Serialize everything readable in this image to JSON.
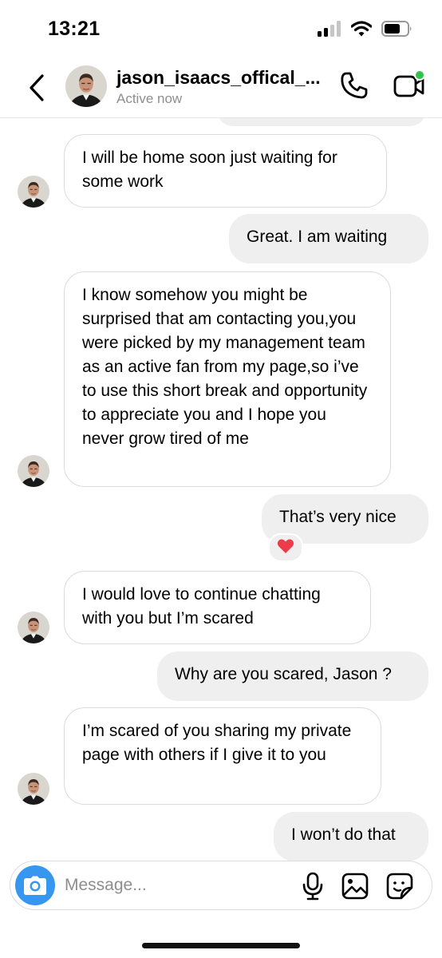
{
  "status_bar": {
    "time": "13:21"
  },
  "header": {
    "username": "jason_isaacs_offical_...",
    "status": "Active now"
  },
  "messages": [
    {
      "from": "them",
      "text": "I will be home soon just waiting for some work"
    },
    {
      "from": "me",
      "text": "Great.   I am waiting"
    },
    {
      "from": "them",
      "text": "I know somehow you might be surprised that am contacting you,you were picked by my management team as an active fan from my page,so i’ve to use this short break and opportunity to appreciate you and I hope you never grow tired of me"
    },
    {
      "from": "me",
      "text": "That’s very nice",
      "reaction": "❤️"
    },
    {
      "from": "them",
      "text": "I would love to continue chatting with you but I’m scared"
    },
    {
      "from": "me",
      "text": "Why are you scared, Jason ?"
    },
    {
      "from": "them",
      "text": "I’m scared of you sharing my private page with others if I give it to you"
    },
    {
      "from": "me",
      "text": "I won’t do that"
    }
  ],
  "composer": {
    "placeholder": "Message..."
  },
  "colors": {
    "accent": "#3797f0",
    "online": "#2ec44a",
    "outgoing_bubble": "#efefef",
    "incoming_border": "#dbdbdb"
  },
  "icons": [
    "signal-icon",
    "wifi-icon",
    "battery-icon",
    "back-arrow-icon",
    "phone-icon",
    "video-call-icon",
    "camera-icon",
    "microphone-icon",
    "gallery-icon",
    "sticker-icon"
  ]
}
